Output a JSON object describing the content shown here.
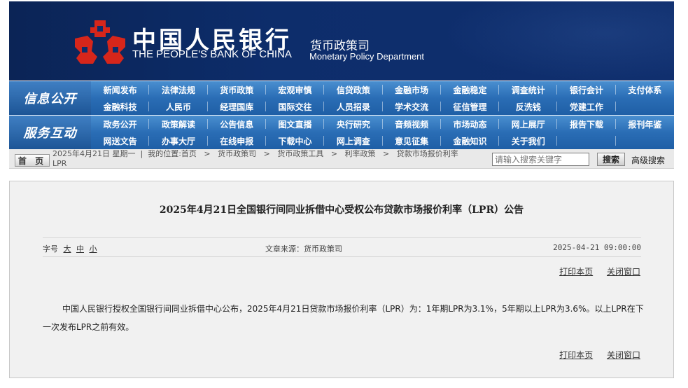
{
  "header": {
    "cn_title": "中国人民银行",
    "en_title": "THE PEOPLE'S BANK OF CHINA",
    "dept_cn": "货币政策司",
    "dept_en": "Monetary Policy Department",
    "brand_red": "#d6261b",
    "banner_navy": "#0d2d6b"
  },
  "nav": {
    "section1_label": "信息公开",
    "section1_items": [
      "新闻发布",
      "法律法规",
      "货币政策",
      "宏观审慎",
      "信贷政策",
      "金融市场",
      "金融稳定",
      "调查统计",
      "银行会计",
      "支付体系",
      "金融科技",
      "人民币",
      "经理国库",
      "国际交往",
      "人员招录",
      "学术交流",
      "征信管理",
      "反洗钱",
      "党建工作",
      ""
    ],
    "section2_label": "服务互动",
    "section2_items": [
      "政务公开",
      "政策解读",
      "公告信息",
      "图文直播",
      "央行研究",
      "音频视频",
      "市场动态",
      "网上展厅",
      "报告下载",
      "报刊年鉴",
      "网送文告",
      "办事大厅",
      "在线申报",
      "下载中心",
      "网上调查",
      "意见征集",
      "金融知识",
      "关于我们",
      "",
      ""
    ]
  },
  "breadcrumb": {
    "home_label": "首 页",
    "date": "2025年4月21日 星期一",
    "location_prefix": "我的位置:",
    "path": [
      "首页",
      "货币政策司",
      "货币政策工具",
      "利率政策",
      "贷款市场报价利率",
      "LPR"
    ]
  },
  "search": {
    "placeholder": "请输入搜索关键字",
    "button": "搜索",
    "advanced": "高级搜索"
  },
  "article": {
    "title": "2025年4月21日全国银行间同业拆借中心受权公布贷款市场报价利率（LPR）公告",
    "font_label": "字号",
    "font_sizes": [
      "大",
      "中",
      "小"
    ],
    "source": "文章来源：货币政策司",
    "date": "2025-04-21 09:00:00",
    "print_label": "打印本页",
    "close_label": "关闭窗口",
    "body": "中国人民银行授权全国银行间同业拆借中心公布，2025年4月21日贷款市场报价利率（LPR）为：1年期LPR为3.1%，5年期以上LPR为3.6%。以上LPR在下一次发布LPR之前有效。"
  }
}
